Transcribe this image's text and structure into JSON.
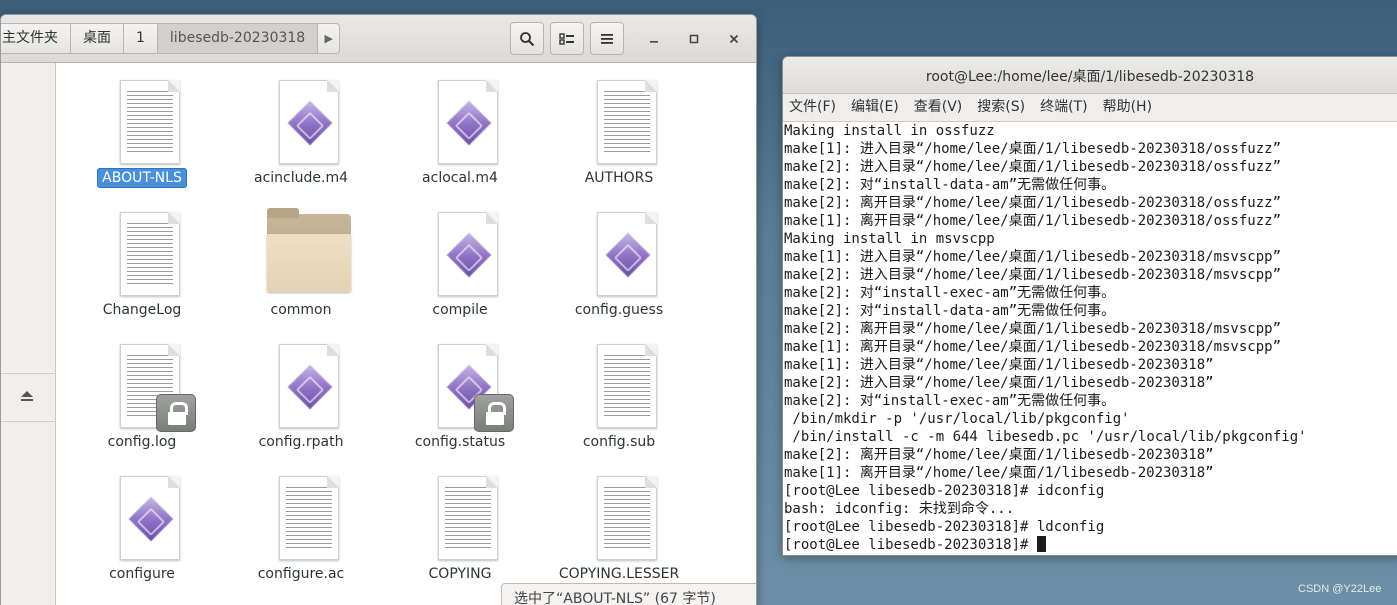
{
  "file_manager": {
    "breadcrumbs": [
      "主文件夹",
      "桌面",
      "1",
      "libesedb-20230318"
    ],
    "files": [
      {
        "name": "ABOUT-NLS",
        "icon": "text-file-icon",
        "selected": true
      },
      {
        "name": "acinclude.m4",
        "icon": "script-file-icon"
      },
      {
        "name": "aclocal.m4",
        "icon": "script-file-icon"
      },
      {
        "name": "AUTHORS",
        "icon": "text-file-icon"
      },
      {
        "name": "ChangeLog",
        "icon": "text-file-icon"
      },
      {
        "name": "common",
        "icon": "folder-icon"
      },
      {
        "name": "compile",
        "icon": "script-file-icon"
      },
      {
        "name": "config.guess",
        "icon": "script-file-icon"
      },
      {
        "name": "config.log",
        "icon": "text-file-icon",
        "locked": true
      },
      {
        "name": "config.rpath",
        "icon": "script-file-icon"
      },
      {
        "name": "config.status",
        "icon": "script-file-icon",
        "locked": true
      },
      {
        "name": "config.sub",
        "icon": "text-file-icon"
      },
      {
        "name": "configure",
        "icon": "script-file-icon"
      },
      {
        "name": "configure.ac",
        "icon": "text-file-icon"
      },
      {
        "name": "COPYING",
        "icon": "text-file-icon"
      },
      {
        "name": "COPYING.LESSER",
        "icon": "text-file-icon"
      }
    ],
    "status": "选中了“ABOUT-NLS” (67 字节)"
  },
  "terminal": {
    "title": "root@Lee:/home/lee/桌面/1/libesedb-20230318",
    "menu": [
      "文件(F)",
      "编辑(E)",
      "查看(V)",
      "搜索(S)",
      "终端(T)",
      "帮助(H)"
    ],
    "lines": [
      "Making install in ossfuzz",
      "make[1]: 进入目录“/home/lee/桌面/1/libesedb-20230318/ossfuzz”",
      "make[2]: 进入目录“/home/lee/桌面/1/libesedb-20230318/ossfuzz”",
      "make[2]: 对“install-data-am”无需做任何事。",
      "make[2]: 离开目录“/home/lee/桌面/1/libesedb-20230318/ossfuzz”",
      "make[1]: 离开目录“/home/lee/桌面/1/libesedb-20230318/ossfuzz”",
      "Making install in msvscpp",
      "make[1]: 进入目录“/home/lee/桌面/1/libesedb-20230318/msvscpp”",
      "make[2]: 进入目录“/home/lee/桌面/1/libesedb-20230318/msvscpp”",
      "make[2]: 对“install-exec-am”无需做任何事。",
      "make[2]: 对“install-data-am”无需做任何事。",
      "make[2]: 离开目录“/home/lee/桌面/1/libesedb-20230318/msvscpp”",
      "make[1]: 离开目录“/home/lee/桌面/1/libesedb-20230318/msvscpp”",
      "make[1]: 进入目录“/home/lee/桌面/1/libesedb-20230318”",
      "make[2]: 进入目录“/home/lee/桌面/1/libesedb-20230318”",
      "make[2]: 对“install-exec-am”无需做任何事。",
      " /bin/mkdir -p '/usr/local/lib/pkgconfig'",
      " /bin/install -c -m 644 libesedb.pc '/usr/local/lib/pkgconfig'",
      "make[2]: 离开目录“/home/lee/桌面/1/libesedb-20230318”",
      "make[1]: 离开目录“/home/lee/桌面/1/libesedb-20230318”",
      "[root@Lee libesedb-20230318]# idconfig",
      "bash: idconfig: 未找到命令...",
      "[root@Lee libesedb-20230318]# ldconfig"
    ],
    "prompt": "[root@Lee libesedb-20230318]# "
  },
  "watermark": "CSDN @Y22Lee"
}
